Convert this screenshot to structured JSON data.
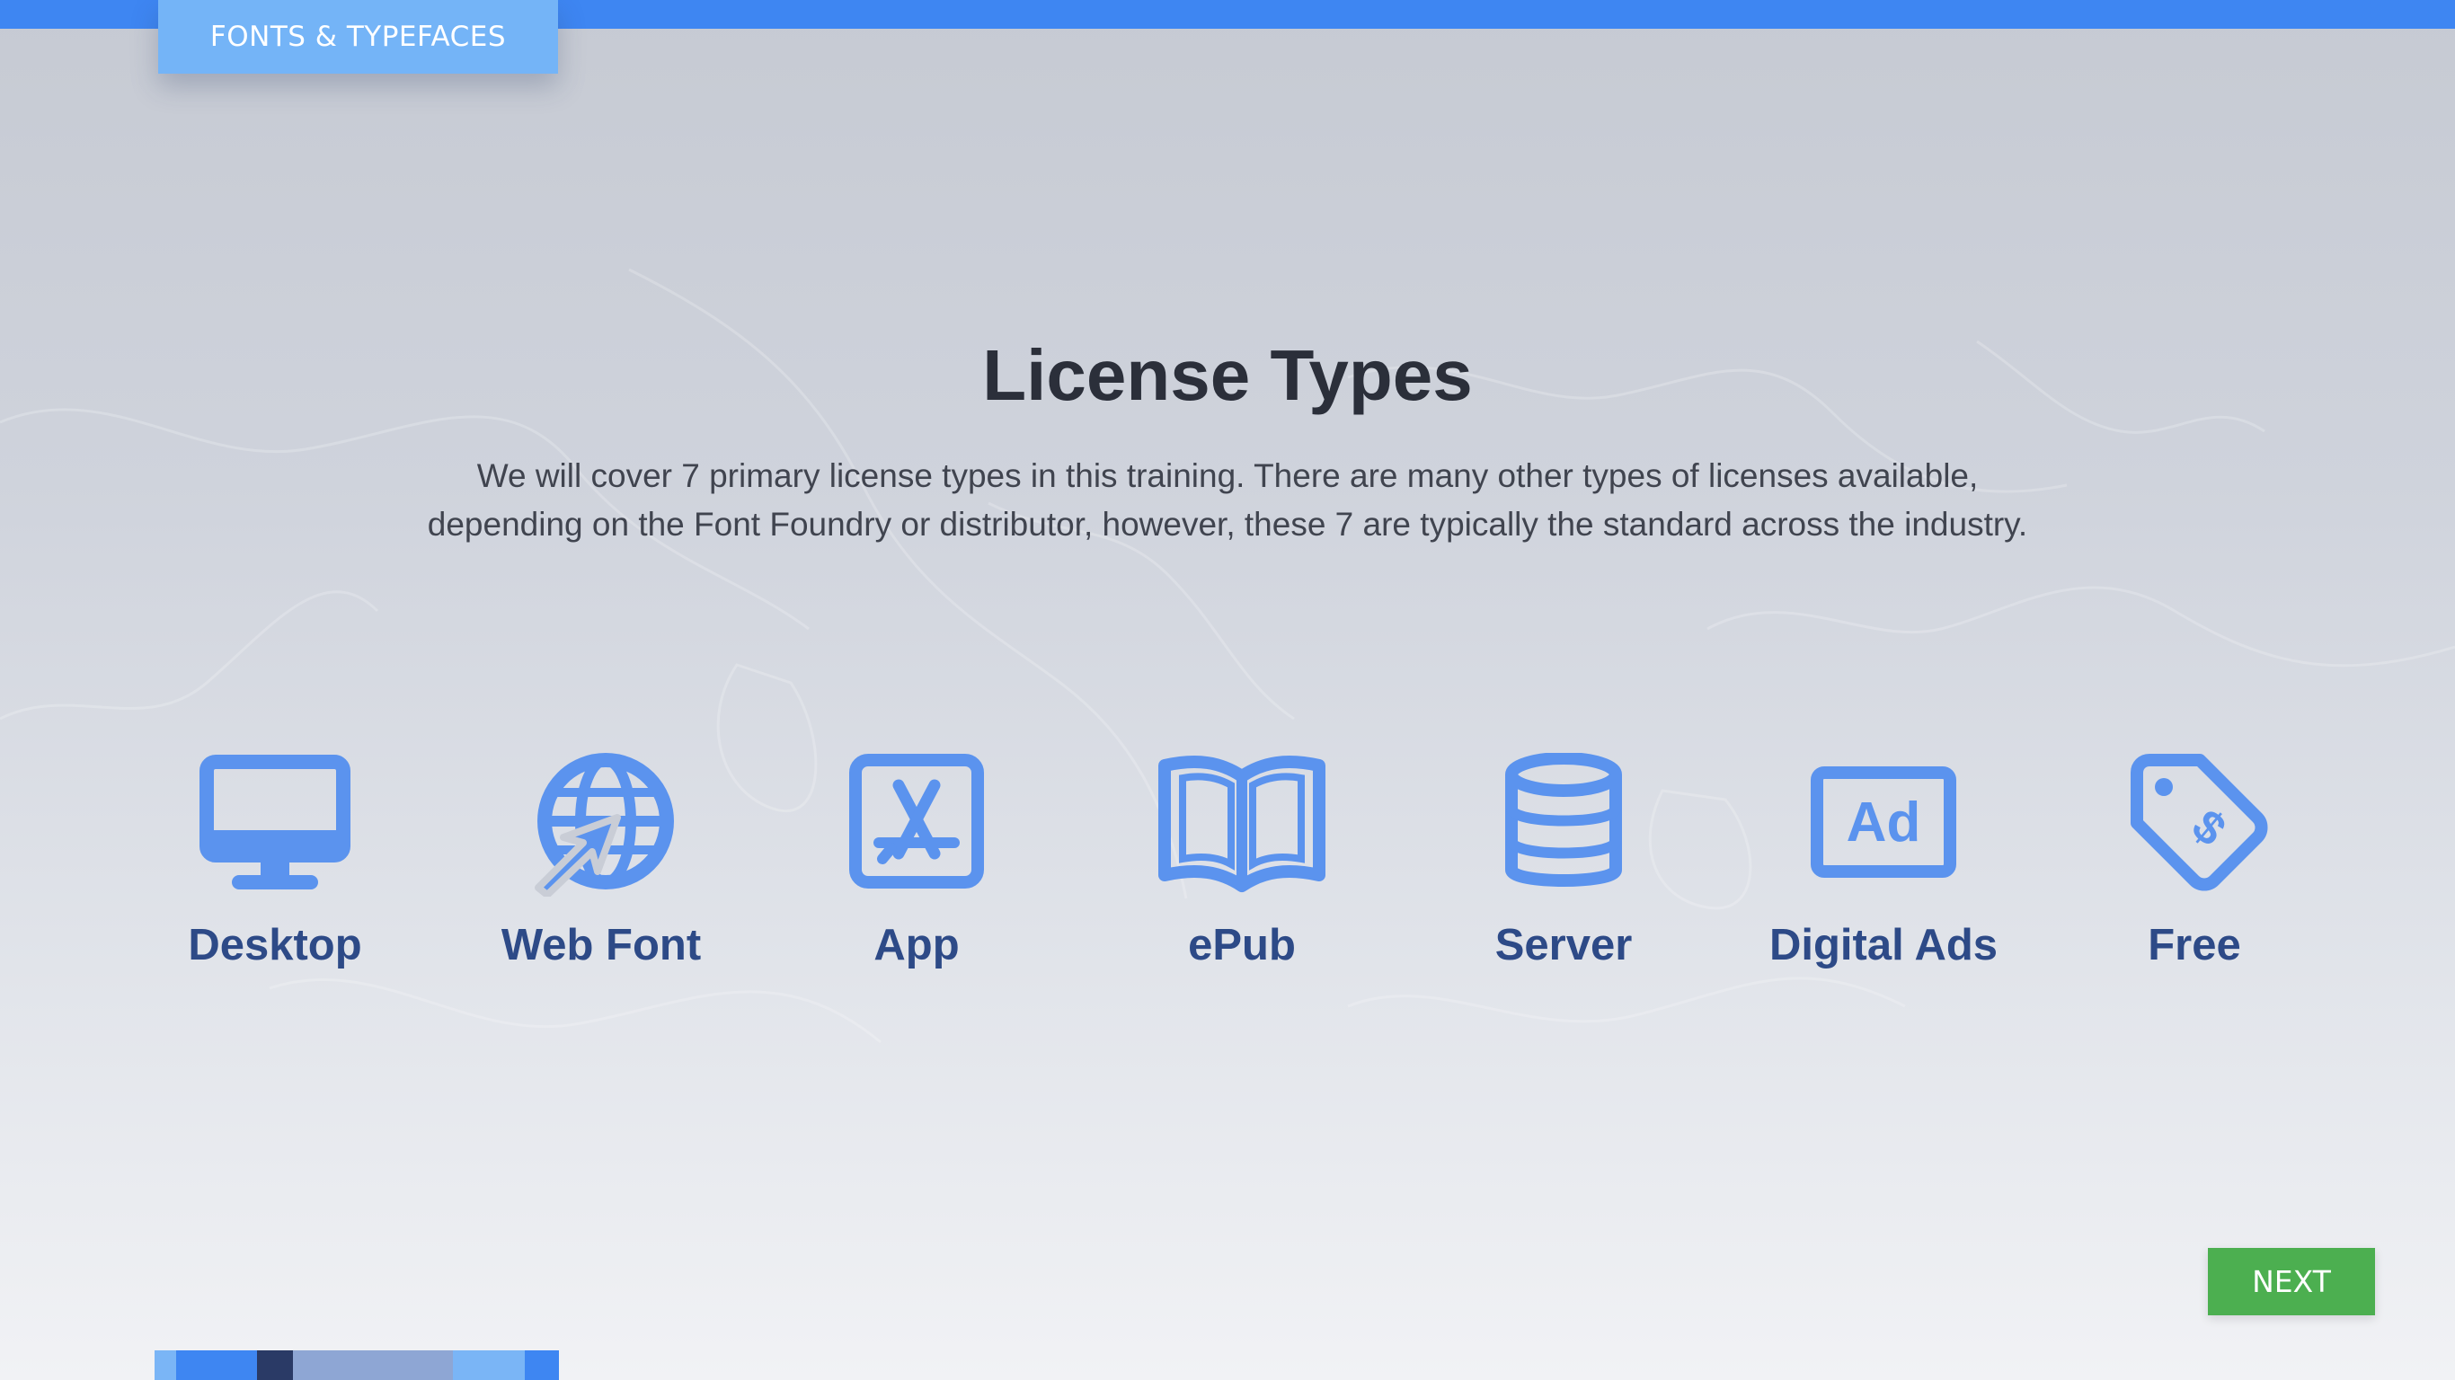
{
  "header": {
    "section_label": "FONTS & TYPEFACES"
  },
  "main": {
    "title": "License Types",
    "description_line1": "We will cover 7 primary license types in this training.  There are many other types of licenses available,",
    "description_line2": "depending on the Font Foundry or distributor, however, these 7 are typically the standard across the industry."
  },
  "licenses": [
    {
      "label": "Desktop",
      "icon": "desktop-icon"
    },
    {
      "label": "Web Font",
      "icon": "globe-cursor-icon"
    },
    {
      "label": "App",
      "icon": "app-store-icon"
    },
    {
      "label": "ePub",
      "icon": "open-book-icon"
    },
    {
      "label": "Server",
      "icon": "database-icon"
    },
    {
      "label": "Digital Ads",
      "icon": "ad-icon"
    },
    {
      "label": "Free",
      "icon": "price-tag-icon"
    }
  ],
  "footer": {
    "next_label": "NEXT"
  },
  "colors": {
    "accent_blue": "#3e86f2",
    "tab_blue": "#74b4f7",
    "icon_blue": "#5b93ee",
    "label_navy": "#2d4a87",
    "next_green": "#4caf50"
  }
}
